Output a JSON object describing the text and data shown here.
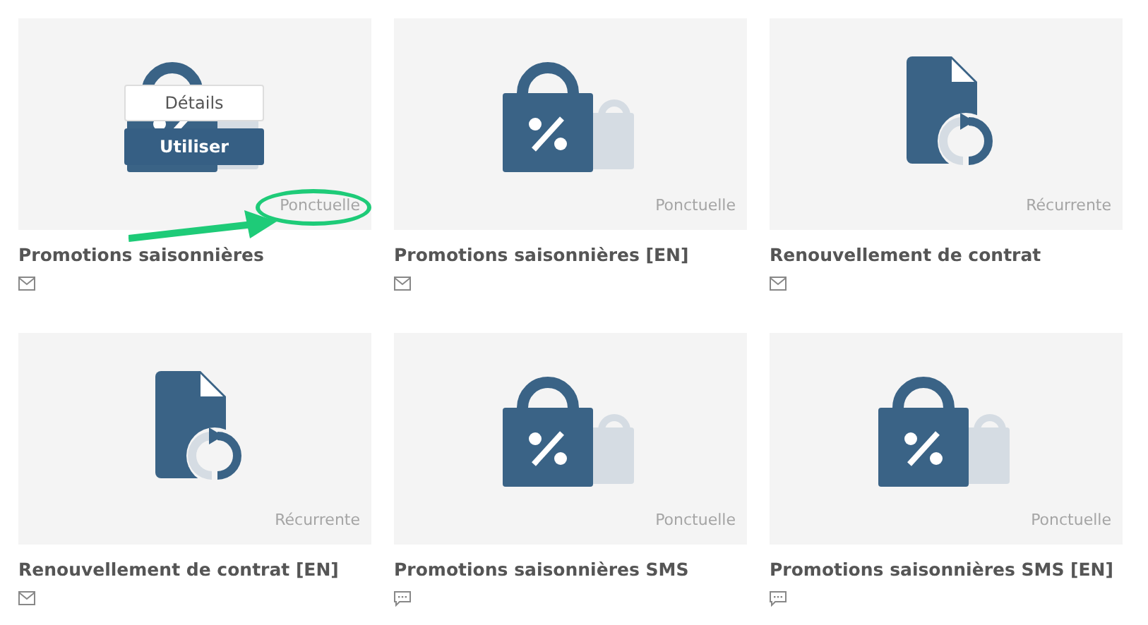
{
  "cards": [
    {
      "title": "Promotions saisonnières",
      "thumbnail": {
        "kind": "promo"
      },
      "channel_icon": {
        "kind": "email"
      },
      "frequency": "Ponctuelle",
      "highlighted": true,
      "actions": [
        {
          "label": "Détails",
          "kind": "secondary"
        },
        {
          "label": "Utiliser",
          "kind": "primary"
        }
      ]
    },
    {
      "title": "Promotions saisonnières [EN]",
      "thumbnail": {
        "kind": "promo"
      },
      "channel_icon": {
        "kind": "email"
      },
      "frequency": "Ponctuelle",
      "highlighted": false
    },
    {
      "title": "Renouvellement de contrat",
      "thumbnail": {
        "kind": "renewal"
      },
      "channel_icon": {
        "kind": "email"
      },
      "frequency": "Récurrente",
      "highlighted": false
    },
    {
      "title": "Renouvellement de contrat [EN]",
      "thumbnail": {
        "kind": "renewal"
      },
      "channel_icon": {
        "kind": "email"
      },
      "frequency": "Récurrente",
      "highlighted": false
    },
    {
      "title": "Promotions saisonnières SMS",
      "thumbnail": {
        "kind": "promo"
      },
      "channel_icon": {
        "kind": "sms"
      },
      "frequency": "Ponctuelle",
      "highlighted": false
    },
    {
      "title": "Promotions saisonnières SMS [EN]",
      "thumbnail": {
        "kind": "promo"
      },
      "channel_icon": {
        "kind": "sms"
      },
      "frequency": "Ponctuelle",
      "highlighted": false
    }
  ]
}
